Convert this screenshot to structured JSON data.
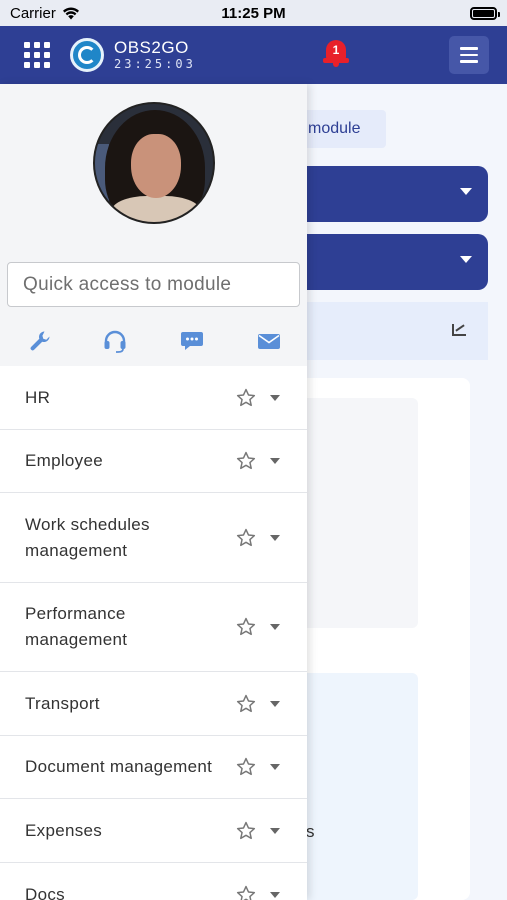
{
  "status_bar": {
    "carrier": "Carrier",
    "time": "11:25 PM"
  },
  "header": {
    "app_name": "OBS2GO",
    "clock": "23:25:03",
    "notification_count": "1",
    "accent_color": "#2e3f94",
    "bell_color": "#e8202a"
  },
  "background": {
    "module_chip": "module",
    "partial_text": "s"
  },
  "drawer": {
    "search": {
      "placeholder": "Quick access to module",
      "value": ""
    },
    "tools": [
      "wrench-icon",
      "headset-icon",
      "chat-icon",
      "mail-icon"
    ],
    "items": [
      {
        "label": "HR"
      },
      {
        "label": "Employee"
      },
      {
        "label": "Work schedules management"
      },
      {
        "label": "Performance management"
      },
      {
        "label": "Transport"
      },
      {
        "label": "Document management"
      },
      {
        "label": "Expenses"
      },
      {
        "label": "Docs"
      }
    ]
  }
}
